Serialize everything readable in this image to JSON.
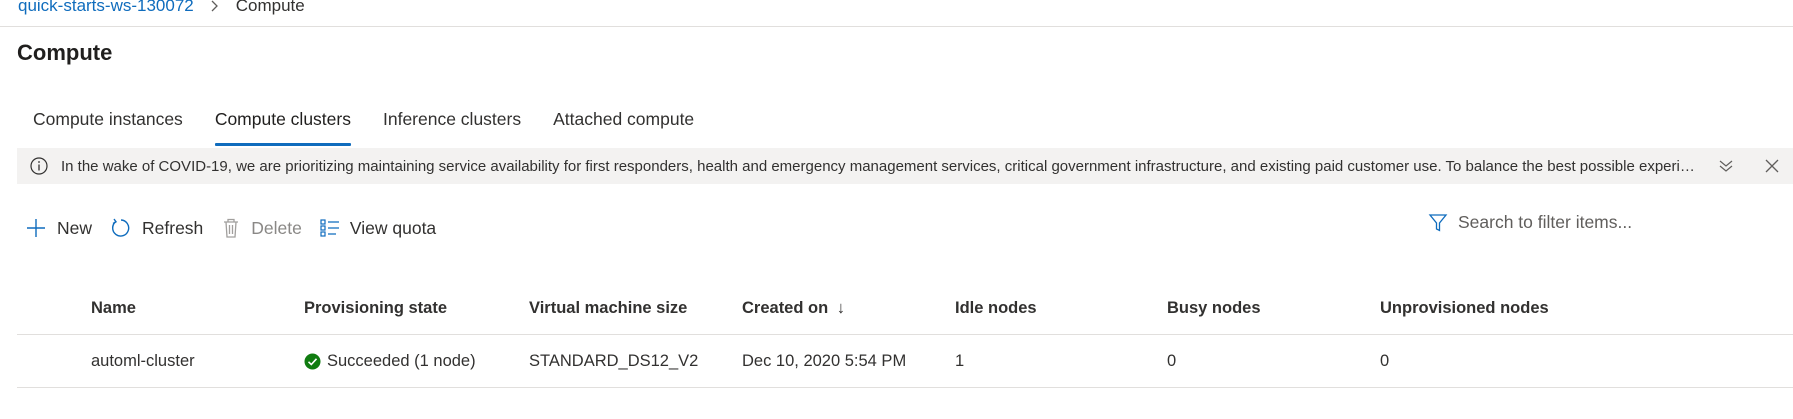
{
  "breadcrumb": {
    "workspace": "quick-starts-ws-130072",
    "current": "Compute"
  },
  "page": {
    "title": "Compute"
  },
  "tabs": [
    {
      "label": "Compute instances"
    },
    {
      "label": "Compute clusters",
      "active": true
    },
    {
      "label": "Inference clusters"
    },
    {
      "label": "Attached compute"
    }
  ],
  "banner": {
    "text": "In the wake of COVID-19, we are prioritizing maintaining service availability for first responders, health and emergency management services, critical government infrastructure, and existing paid customer use. To balance the best possible experience for all customers, we are restricting some new compute creation."
  },
  "toolbar": {
    "new_label": "New",
    "refresh_label": "Refresh",
    "delete_label": "Delete",
    "view_quota_label": "View quota"
  },
  "search": {
    "placeholder": "Search to filter items..."
  },
  "table": {
    "columns": [
      "Name",
      "Provisioning state",
      "Virtual machine size",
      "Created on",
      "Idle nodes",
      "Busy nodes",
      "Unprovisioned nodes"
    ],
    "sort_indicator": "↓",
    "rows": [
      {
        "name": "automl-cluster",
        "state": "Succeeded (1 node)",
        "vm_size": "STANDARD_DS12_V2",
        "created_on": "Dec 10, 2020 5:54 PM",
        "idle": "1",
        "busy": "0",
        "unprovisioned": "0"
      }
    ]
  },
  "colors": {
    "accent": "#0f6cbd",
    "success": "#107c10",
    "banner_bg": "#f3f2f1"
  },
  "icons": [
    "chevron-right-icon",
    "info-icon",
    "expand-icon",
    "close-icon",
    "plus-icon",
    "refresh-icon",
    "trash-icon",
    "quota-list-icon",
    "filter-icon",
    "success-check-icon",
    "sort-down-icon"
  ]
}
